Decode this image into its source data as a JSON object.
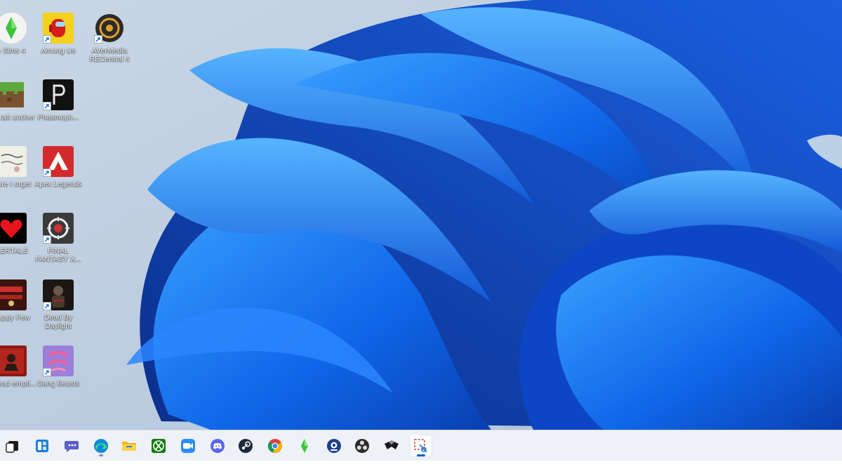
{
  "desktop": {
    "icons": [
      {
        "label": "e Sims 4",
        "icon": "sims-plumbob-icon"
      },
      {
        "label": "Among Us",
        "icon": "among-us-crewmate-icon"
      },
      {
        "label": "AVerMedia RECentral 4",
        "icon": "avermedia-lens-icon"
      },
      {
        "label": "necraft uncher",
        "icon": "minecraft-grass-block-icon"
      },
      {
        "label": "Phasmoph...",
        "icon": "phasmophobia-p-icon"
      },
      {
        "label": "efore I orget",
        "icon": "before-i-forget-icon"
      },
      {
        "label": "Apex Legends",
        "icon": "apex-legends-icon"
      },
      {
        "label": "DERTALE",
        "icon": "undertale-heart-icon"
      },
      {
        "label": "FINAL FANTASY X...",
        "icon": "final-fantasy-icon"
      },
      {
        "label": "Happy Few",
        "icon": "we-happy-few-icon"
      },
      {
        "label": "Dead By Daylight",
        "icon": "dead-by-daylight-icon"
      },
      {
        "label": "d Dead empti...",
        "icon": "red-dead-redemption-icon"
      },
      {
        "label": "Gang Beasts",
        "icon": "gang-beasts-icon"
      }
    ]
  },
  "taskbar": {
    "items": [
      {
        "icon": "task-view-icon"
      },
      {
        "icon": "widgets-icon"
      },
      {
        "icon": "teams-chat-icon"
      },
      {
        "icon": "edge-icon"
      },
      {
        "icon": "file-explorer-icon"
      },
      {
        "icon": "xbox-icon"
      },
      {
        "icon": "zoom-icon"
      },
      {
        "icon": "discord-icon"
      },
      {
        "icon": "steam-icon"
      },
      {
        "icon": "chrome-icon"
      },
      {
        "icon": "sims-plumbob-icon"
      },
      {
        "icon": "avermedia-icon"
      },
      {
        "icon": "obs-icon"
      },
      {
        "icon": "app-logo-icon"
      },
      {
        "icon": "snipping-tool-icon"
      }
    ]
  },
  "colors": {
    "accent": "#0067c0",
    "wallpaper_blue": "#1a73f0",
    "taskbar_bg": "#eef1f6"
  }
}
